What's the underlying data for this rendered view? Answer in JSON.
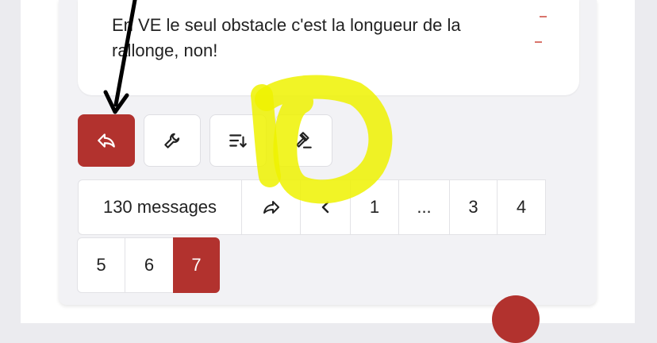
{
  "message": {
    "text": "En VE le seul obstacle c'est la longueur de la rallonge, non!"
  },
  "actions": [
    {
      "name": "reply",
      "icon": "reply-icon"
    },
    {
      "name": "moderate",
      "icon": "wrench-icon"
    },
    {
      "name": "sort",
      "icon": "sort-descending-icon"
    },
    {
      "name": "judge",
      "icon": "gavel-icon"
    }
  ],
  "pagination": {
    "count_label": "130 messages",
    "share_icon": "share-arrow-icon",
    "prev_icon": "chevron-left-icon",
    "pages": [
      "1",
      "...",
      "3",
      "4",
      "5",
      "6",
      "7"
    ],
    "current_page": "7"
  },
  "colors": {
    "accent": "#b2322e",
    "highlight": "#eef200",
    "annotation_arrow": "#000000"
  }
}
